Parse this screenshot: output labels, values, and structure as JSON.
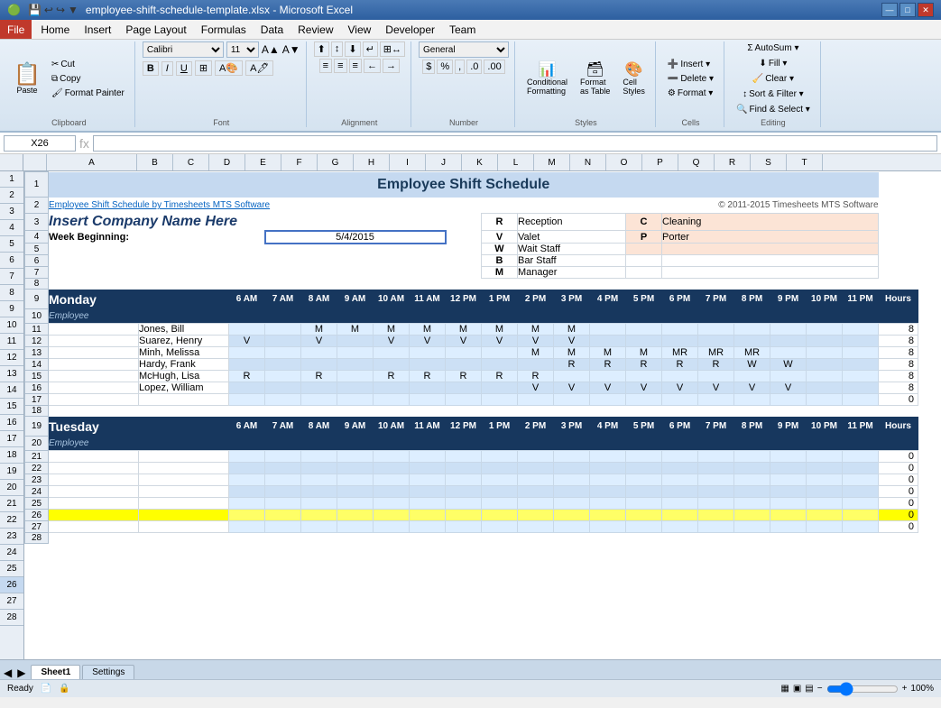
{
  "window": {
    "title": "employee-shift-schedule-template.xlsx - Microsoft Excel",
    "min": "—",
    "max": "□",
    "close": "✕"
  },
  "menus": [
    "File",
    "Home",
    "Insert",
    "Page Layout",
    "Formulas",
    "Data",
    "Review",
    "View",
    "Developer",
    "Team"
  ],
  "ribbon": {
    "active_tab": "Home",
    "clipboard": {
      "paste": "Paste",
      "cut": "✂",
      "copy": "⧉",
      "format_painter": "🖌"
    },
    "font": {
      "name": "Calibri",
      "size": "11",
      "bold": "B",
      "italic": "I",
      "underline": "U"
    },
    "number_format": "General",
    "groups": [
      "Clipboard",
      "Font",
      "Alignment",
      "Number",
      "Styles",
      "Cells",
      "Editing"
    ]
  },
  "formula_bar": {
    "name_box": "X26",
    "formula": ""
  },
  "spreadsheet": {
    "title": "Employee Shift Schedule",
    "company_name": "Insert Company Name Here",
    "info_link": "Employee Shift Schedule by Timesheets MTS Software",
    "copyright": "© 2011-2015 Timesheets MTS Software",
    "week_beginning_label": "Week Beginning:",
    "week_date": "5/4/2015",
    "legend": {
      "headers": [
        "",
        "",
        "",
        ""
      ],
      "rows": [
        {
          "code1": "R",
          "name1": "Reception",
          "code2": "C",
          "name2": "Cleaning"
        },
        {
          "code1": "V",
          "name1": "Valet",
          "code2": "P",
          "name2": "Porter"
        },
        {
          "code1": "W",
          "name1": "Wait Staff",
          "code2": "",
          "name2": ""
        },
        {
          "code1": "B",
          "name1": "Bar Staff",
          "code2": "",
          "name2": ""
        },
        {
          "code1": "M",
          "name1": "Manager",
          "code2": "",
          "name2": ""
        }
      ]
    },
    "monday": {
      "day": "Monday",
      "hours_label": "Hours",
      "employee_label": "Employee",
      "time_slots": [
        "6 AM",
        "7 AM",
        "8 AM",
        "9 AM",
        "10 AM",
        "11 AM",
        "12 PM",
        "1 PM",
        "2 PM",
        "3 PM",
        "4 PM",
        "5 PM",
        "6 PM",
        "7 PM",
        "8 PM",
        "9 PM",
        "10 PM",
        "11 PM"
      ],
      "employees": [
        {
          "name": "Jones, Bill",
          "slots": [
            "",
            "",
            "M",
            "M",
            "M",
            "M",
            "M",
            "M",
            "M",
            "M",
            "",
            "",
            "",
            "",
            "",
            "",
            "",
            ""
          ],
          "hours": "8"
        },
        {
          "name": "Suarez, Henry",
          "slots": [
            "V",
            "",
            "V",
            "",
            "V",
            "V",
            "V",
            "V",
            "V",
            "V",
            "",
            "",
            "",
            "",
            "",
            "",
            "",
            ""
          ],
          "hours": "8"
        },
        {
          "name": "Minh, Melissa",
          "slots": [
            "",
            "",
            "",
            "",
            "",
            "",
            "",
            "",
            "M",
            "M",
            "M",
            "M",
            "MR",
            "MR",
            "MR",
            "",
            "",
            ""
          ],
          "hours": "8"
        },
        {
          "name": "Hardy, Frank",
          "slots": [
            "",
            "",
            "",
            "",
            "",
            "",
            "",
            "",
            "",
            "R",
            "R",
            "R",
            "R",
            "R",
            "W",
            "W",
            "",
            ""
          ],
          "hours": "8"
        },
        {
          "name": "McHugh, Lisa",
          "slots": [
            "R",
            "",
            "R",
            "",
            "R",
            "R",
            "R",
            "R",
            "R",
            "",
            "",
            "",
            "",
            "",
            "",
            "",
            "",
            ""
          ],
          "hours": "8"
        },
        {
          "name": "Lopez, William",
          "slots": [
            "",
            "",
            "",
            "",
            "",
            "",
            "",
            "",
            "V",
            "V",
            "V",
            "V",
            "V",
            "V",
            "V",
            "V",
            "",
            ""
          ],
          "hours": "8"
        },
        {
          "name": "",
          "slots": [
            "",
            "",
            "",
            "",
            "",
            "",
            "",
            "",
            "",
            "",
            "",
            "",
            "",
            "",
            "",
            "",
            "",
            ""
          ],
          "hours": "0"
        }
      ]
    },
    "tuesday": {
      "day": "Tuesday",
      "employee_label": "Employee",
      "time_slots": [
        "6 AM",
        "7 AM",
        "8 AM",
        "9 AM",
        "10 AM",
        "11 AM",
        "12 PM",
        "1 PM",
        "2 PM",
        "3 PM",
        "4 PM",
        "5 PM",
        "6 PM",
        "7 PM",
        "8 PM",
        "9 PM",
        "10 PM",
        "11 PM"
      ],
      "employees": [
        {
          "name": "",
          "slots": [
            "",
            "",
            "",
            "",
            "",
            "",
            "",
            "",
            "",
            "",
            "",
            "",
            "",
            "",
            "",
            "",
            "",
            ""
          ],
          "hours": "0"
        },
        {
          "name": "",
          "slots": [
            "",
            "",
            "",
            "",
            "",
            "",
            "",
            "",
            "",
            "",
            "",
            "",
            "",
            "",
            "",
            "",
            "",
            ""
          ],
          "hours": "0"
        },
        {
          "name": "",
          "slots": [
            "",
            "",
            "",
            "",
            "",
            "",
            "",
            "",
            "",
            "",
            "",
            "",
            "",
            "",
            "",
            "",
            "",
            ""
          ],
          "hours": "0"
        },
        {
          "name": "",
          "slots": [
            "",
            "",
            "",
            "",
            "",
            "",
            "",
            "",
            "",
            "",
            "",
            "",
            "",
            "",
            "",
            "",
            "",
            ""
          ],
          "hours": "0"
        },
        {
          "name": "",
          "slots": [
            "",
            "",
            "",
            "",
            "",
            "",
            "",
            "",
            "",
            "",
            "",
            "",
            "",
            "",
            "",
            "",
            "",
            ""
          ],
          "hours": "0"
        },
        {
          "name": "",
          "slots": [
            "",
            "",
            "",
            "",
            "",
            "",
            "",
            "",
            "",
            "",
            "",
            "",
            "",
            "",
            "",
            "",
            "",
            ""
          ],
          "hours": "0"
        },
        {
          "name": "",
          "slots": [
            "",
            "",
            "",
            "",
            "",
            "",
            "",
            "",
            "",
            "",
            "",
            "",
            "",
            "",
            "",
            "",
            "",
            ""
          ],
          "hours": "0"
        }
      ]
    }
  },
  "col_headers": [
    "A",
    "B",
    "C",
    "D",
    "E",
    "F",
    "G",
    "H",
    "I",
    "J",
    "K",
    "L",
    "M",
    "N",
    "O",
    "P",
    "Q",
    "R",
    "S",
    "T"
  ],
  "row_headers": [
    "1",
    "2",
    "3",
    "4",
    "5",
    "6",
    "7",
    "8",
    "9",
    "10",
    "11",
    "12",
    "13",
    "14",
    "15",
    "16",
    "17",
    "18",
    "19",
    "20",
    "21",
    "22",
    "23",
    "24",
    "25",
    "26",
    "27",
    "28"
  ],
  "sheet_tabs": [
    "Sheet1",
    "Settings"
  ],
  "status": {
    "ready": "Ready",
    "zoom": "100%"
  }
}
